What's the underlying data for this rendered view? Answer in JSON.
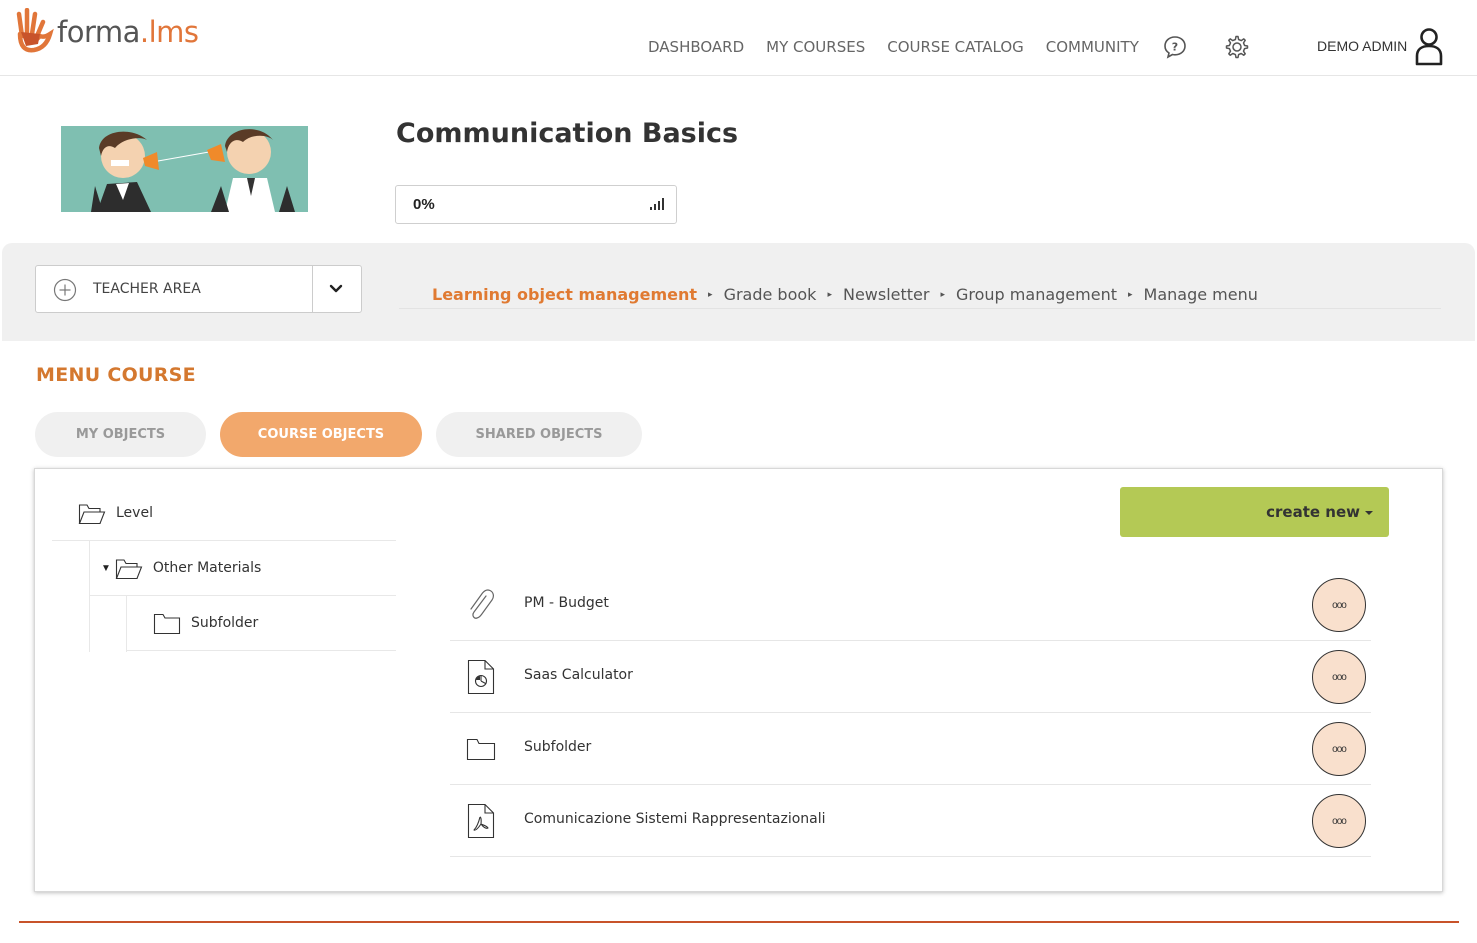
{
  "brand": {
    "name_part1": "forma",
    "name_dot": ".",
    "name_part2": "lms",
    "accent_color": "#e1763a"
  },
  "nav": {
    "items": [
      "DASHBOARD",
      "MY COURSES",
      "COURSE CATALOG",
      "COMMUNITY"
    ],
    "help_icon": "question-bubble-icon",
    "settings_icon": "gear-icon",
    "user_name": "DEMO ADMIN",
    "user_icon": "user-icon"
  },
  "course": {
    "title": "Communication Basics",
    "progress_label": "0%",
    "progress_value": 0
  },
  "teacher_area": {
    "label": "TEACHER AREA"
  },
  "breadcrumb": {
    "items": [
      {
        "label": "Learning object management",
        "active": true
      },
      {
        "label": "Grade book",
        "active": false
      },
      {
        "label": "Newsletter",
        "active": false
      },
      {
        "label": "Group management",
        "active": false
      },
      {
        "label": "Manage menu",
        "active": false
      }
    ]
  },
  "menu": {
    "title": "MENU COURSE",
    "tabs": [
      {
        "label": "MY OBJECTS",
        "active": false
      },
      {
        "label": "COURSE OBJECTS",
        "active": true
      },
      {
        "label": "SHARED OBJECTS",
        "active": false
      }
    ]
  },
  "tree": {
    "level": "Level",
    "other": "Other Materials",
    "sub": "Subfolder"
  },
  "toolbar": {
    "create_label": "create new"
  },
  "objects": [
    {
      "name": "PM - Budget",
      "icon": "paperclip-icon"
    },
    {
      "name": "Saas Calculator",
      "icon": "spreadsheet-file-icon"
    },
    {
      "name": "Subfolder",
      "icon": "folder-icon"
    },
    {
      "name": "Comunicazione Sistemi Rappresentazionali",
      "icon": "pdf-file-icon"
    }
  ],
  "object_menu_glyph": "ooo",
  "colors": {
    "orange": "#e07a32",
    "tab_active": "#f2a86c",
    "create_button": "#b4c955",
    "menu_circle": "#f9e0cd",
    "band": "#f0f0f0"
  }
}
